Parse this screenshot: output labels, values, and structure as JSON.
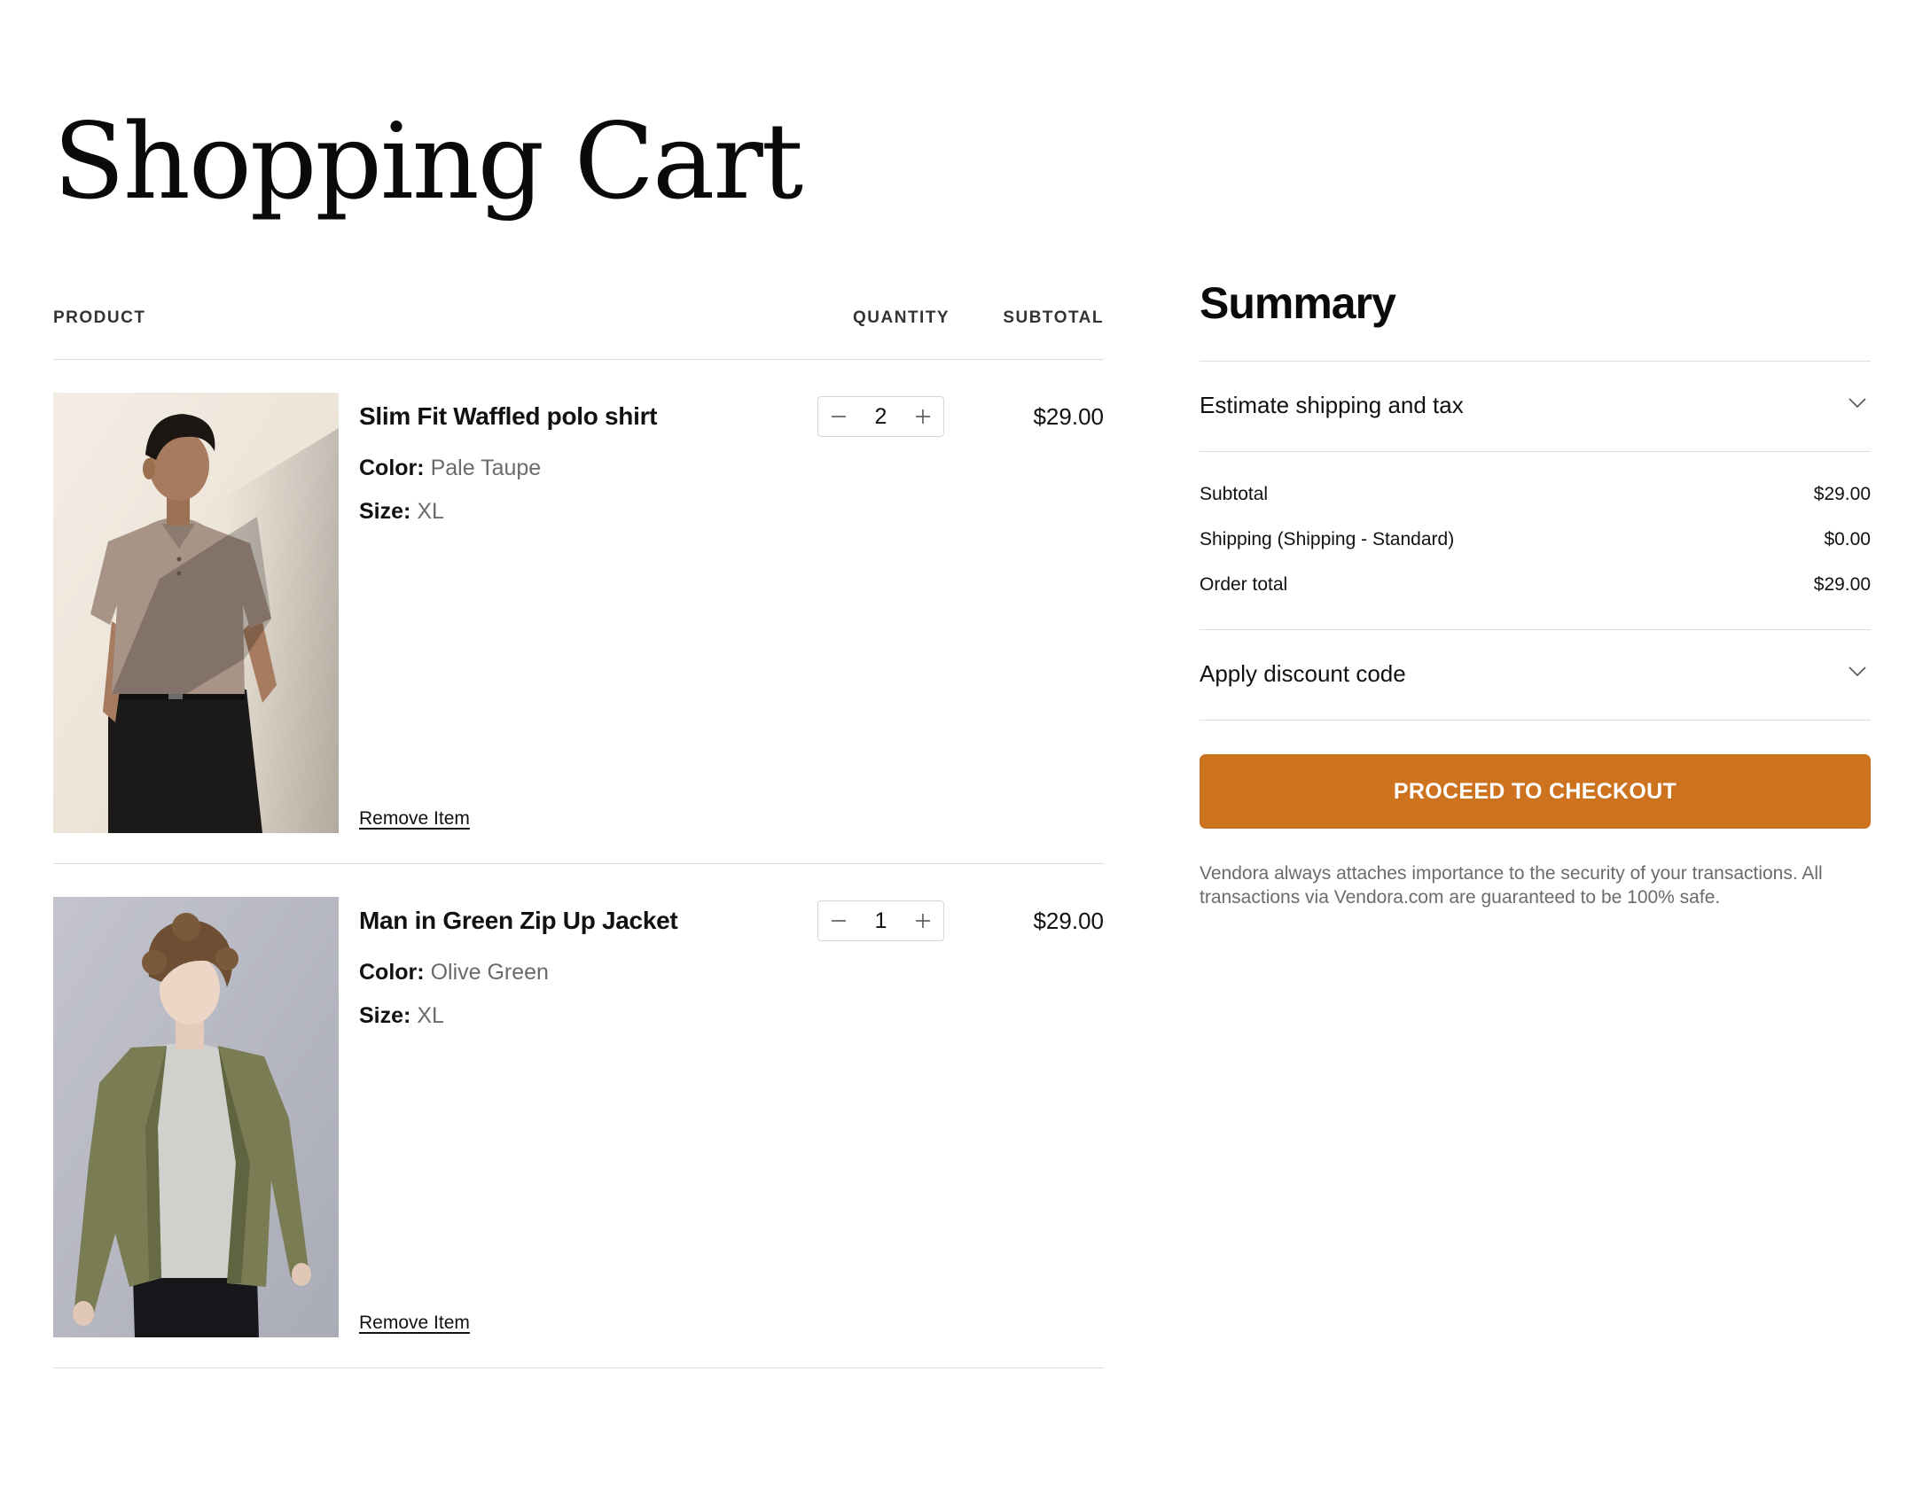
{
  "page": {
    "title": "Shopping Cart"
  },
  "cart": {
    "columns": {
      "product": "PRODUCT",
      "quantity": "QUANTITY",
      "subtotal": "SUBTOTAL"
    },
    "color_label": "Color:",
    "size_label": "Size:",
    "remove_label": "Remove Item",
    "items": [
      {
        "name": "Slim Fit Waffled polo shirt",
        "color": "Pale Taupe",
        "size": "XL",
        "quantity": "2",
        "price": "$29.00"
      },
      {
        "name": "Man in Green Zip Up Jacket",
        "color": "Olive Green",
        "size": "XL",
        "quantity": "1",
        "price": "$29.00"
      }
    ]
  },
  "summary": {
    "title": "Summary",
    "shipping_accordion": "Estimate shipping and tax",
    "rows": {
      "subtotal_label": "Subtotal",
      "subtotal_value": "$29.00",
      "shipping_label": "Shipping (Shipping - Standard)",
      "shipping_value": "$0.00",
      "total_label": "Order total",
      "total_value": "$29.00"
    },
    "discount_accordion": "Apply discount code",
    "checkout_label": "PROCEED TO CHECKOUT",
    "security_note": "Vendora always attaches importance to the security of your transactions. All transactions via Vendora.com are guaranteed to be 100% safe."
  },
  "colors": {
    "checkout_button": "#cd7320",
    "divider": "#dcdcdc",
    "muted_text": "#6b6b6b"
  },
  "icons": {
    "quantity_decrease": "minus-icon",
    "quantity_increase": "plus-icon",
    "accordion_toggle": "chevron-down-icon"
  }
}
